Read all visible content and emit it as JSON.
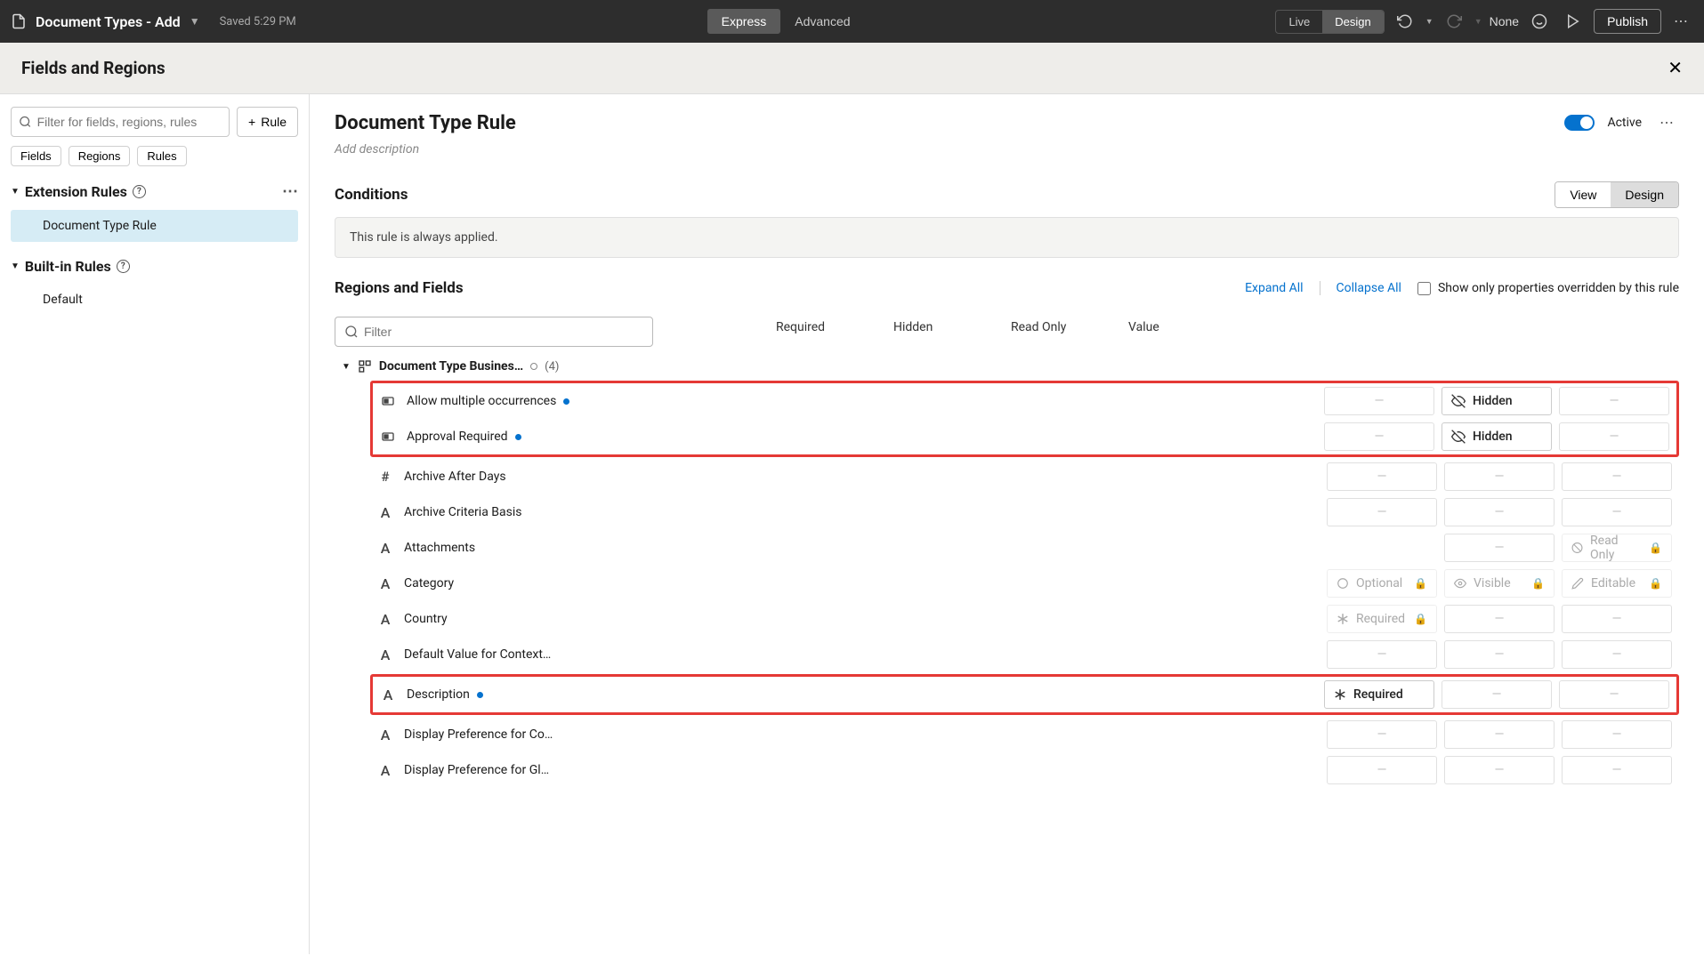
{
  "topbar": {
    "title": "Document Types - Add",
    "saved": "Saved 5:29 PM",
    "modes": {
      "express": "Express",
      "advanced": "Advanced"
    },
    "live": "Live",
    "design": "Design",
    "none": "None",
    "publish": "Publish"
  },
  "page_header": {
    "title": "Fields and Regions"
  },
  "sidebar": {
    "search_placeholder": "Filter for fields, regions, rules",
    "add_rule": "Rule",
    "chips": [
      "Fields",
      "Regions",
      "Rules"
    ],
    "extension_rules_label": "Extension Rules",
    "extension_items": [
      "Document Type Rule"
    ],
    "builtin_rules_label": "Built-in Rules",
    "builtin_items": [
      "Default"
    ]
  },
  "main": {
    "rule_title": "Document Type Rule",
    "active_label": "Active",
    "desc_placeholder": "Add description",
    "conditions_label": "Conditions",
    "view": "View",
    "design": "Design",
    "condition_text": "This rule is always applied.",
    "regions_label": "Regions and Fields",
    "expand_all": "Expand All",
    "collapse_all": "Collapse All",
    "show_overridden": "Show only properties overridden by this rule",
    "filter_placeholder": "Filter",
    "columns": {
      "required": "Required",
      "hidden": "Hidden",
      "readonly": "Read Only",
      "value": "Value"
    },
    "group": {
      "name": "Document Type Busines…",
      "count": "(4)"
    },
    "fields": [
      {
        "icon": "checkbox",
        "name": "Allow multiple occurrences",
        "modified": true,
        "req": "dash",
        "hidden": "Hidden",
        "ro": "dash",
        "highlight": "top1"
      },
      {
        "icon": "checkbox",
        "name": "Approval Required",
        "modified": true,
        "req": "dash",
        "hidden": "Hidden",
        "ro": "dash",
        "highlight": "top1"
      },
      {
        "icon": "hash",
        "name": "Archive After Days",
        "req": "dash",
        "hidden": "dash",
        "ro": "dash"
      },
      {
        "icon": "A",
        "name": "Archive Criteria Basis",
        "req": "dash",
        "hidden": "dash",
        "ro": "dash"
      },
      {
        "icon": "A",
        "name": "Attachments",
        "req": "blank",
        "hidden": "dash",
        "ro_locked": "Read Only"
      },
      {
        "icon": "A",
        "name": "Category",
        "req_locked": "Optional",
        "hidden_locked": "Visible",
        "ro_locked": "Editable"
      },
      {
        "icon": "A",
        "name": "Country",
        "req_locked": "Required",
        "req_locked_icon": "asterisk",
        "hidden": "dash",
        "ro": "dash"
      },
      {
        "icon": "A",
        "name": "Default Value for Context…",
        "req": "dash",
        "hidden": "dash",
        "ro": "dash"
      },
      {
        "icon": "A",
        "name": "Description",
        "modified": true,
        "req_set": "Required",
        "hidden": "dash",
        "ro": "dash",
        "highlight": "single"
      },
      {
        "icon": "A",
        "name": "Display Preference for Co…",
        "req": "dash",
        "hidden": "dash",
        "ro": "dash"
      },
      {
        "icon": "A",
        "name": "Display Preference for Gl…",
        "req": "dash",
        "hidden": "dash",
        "ro": "dash"
      }
    ]
  }
}
